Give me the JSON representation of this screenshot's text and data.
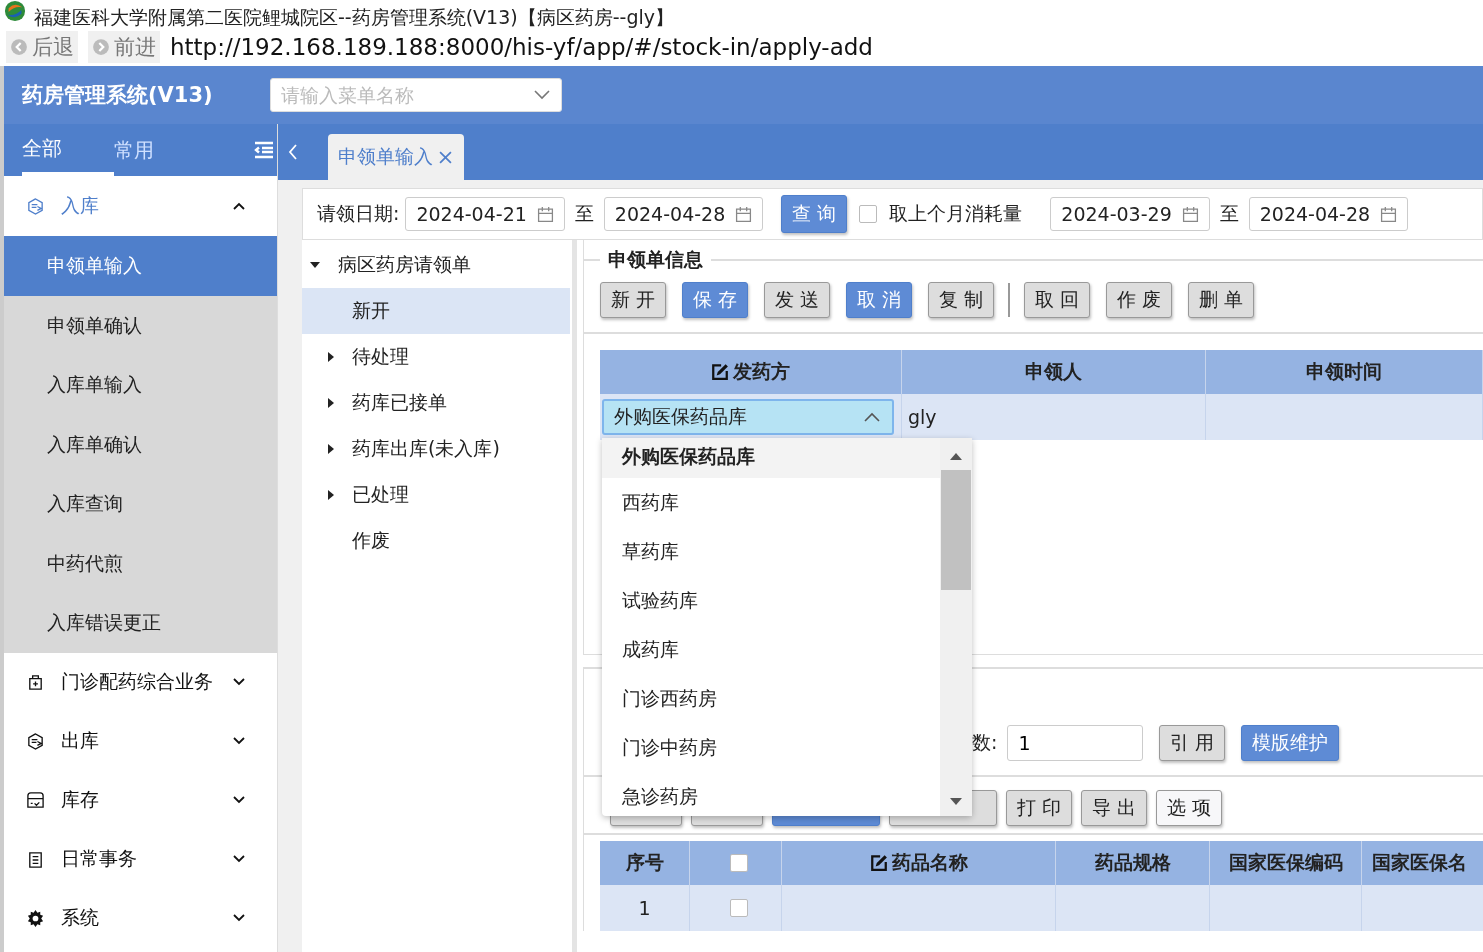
{
  "window": {
    "title": "福建医科大学附属第二医院鲤城院区--药房管理系统(V13)【病区药房--gly】",
    "back": "后退",
    "forward": "前进",
    "url": "http://192.168.189.188:8000/his-yf/app/#/stock-in/apply-add"
  },
  "header": {
    "app_name": "药房管理系统(V13)",
    "menu_search": {
      "placeholder": "请输入菜单名称"
    }
  },
  "sidebar": {
    "tabs": [
      {
        "label": "全部",
        "selected": true
      },
      {
        "label": "常用",
        "selected": false
      }
    ],
    "groups": [
      {
        "label": "入库",
        "kind": "stock-in",
        "expanded": true,
        "children": [
          {
            "label": "申领单输入",
            "selected": true
          },
          {
            "label": "申领单确认",
            "selected": false
          },
          {
            "label": "入库单输入",
            "selected": false
          },
          {
            "label": "入库单确认",
            "selected": false
          },
          {
            "label": "入库查询",
            "selected": false
          },
          {
            "label": "中药代煎",
            "selected": false
          },
          {
            "label": "入库错误更正",
            "selected": false
          }
        ]
      },
      {
        "label": "门诊配药综合业务",
        "kind": "kit",
        "expanded": false
      },
      {
        "label": "出库",
        "kind": "stock-out",
        "expanded": false
      },
      {
        "label": "库存",
        "kind": "inventory",
        "expanded": false
      },
      {
        "label": "日常事务",
        "kind": "daily",
        "expanded": false
      },
      {
        "label": "系统",
        "kind": "system",
        "expanded": false
      }
    ]
  },
  "page_tabs": [
    {
      "label": "申领单输入",
      "selected": true
    }
  ],
  "filter": {
    "label": "请领日期:",
    "date_from": "2024-04-21",
    "sep": "至",
    "date_to": "2024-04-28",
    "query_button": "查 询",
    "consumption": {
      "label": "取上个月消耗量",
      "checked": false
    },
    "cons_from": "2024-03-29",
    "cons_sep": "至",
    "cons_to": "2024-04-28"
  },
  "tree": [
    {
      "label": "病区药房请领单",
      "expanded": true,
      "children": [
        {
          "label": "新开",
          "selected": true
        },
        {
          "label": "待处理",
          "selected": false,
          "expanded": false
        },
        {
          "label": "药库已接单",
          "selected": false,
          "expanded": false
        },
        {
          "label": "药库出库(未入库)",
          "selected": false,
          "expanded": false
        },
        {
          "label": "已处理",
          "selected": false,
          "expanded": false
        },
        {
          "label": "作废",
          "selected": false
        }
      ]
    }
  ],
  "form": {
    "title": "申领单信息",
    "button_groups": [
      [
        {
          "label": "新 开",
          "kind": "default"
        },
        {
          "label": "保 存",
          "kind": "primary"
        },
        {
          "label": "发 送",
          "kind": "default"
        },
        {
          "label": "取 消",
          "kind": "primary"
        },
        {
          "label": "复 制",
          "kind": "default"
        }
      ],
      [
        {
          "label": "取 回",
          "kind": "default"
        },
        {
          "label": "作 废",
          "kind": "default"
        },
        {
          "label": "删 单",
          "kind": "default"
        }
      ]
    ],
    "columns": [
      {
        "label": "发药方",
        "editable": true
      },
      {
        "label": "申领人",
        "editable": false
      },
      {
        "label": "申领时间",
        "editable": false
      }
    ],
    "row": {
      "supplier": "外购医保药品库",
      "open": true,
      "applicant": "gly"
    },
    "supplier_options": [
      {
        "label": "外购医保药品库",
        "selected": true
      },
      {
        "label": "西药库",
        "selected": false
      },
      {
        "label": "草药库",
        "selected": false
      },
      {
        "label": "试验药库",
        "selected": false
      },
      {
        "label": "成药库",
        "selected": false
      },
      {
        "label": "门诊西药房",
        "selected": false
      },
      {
        "label": "门诊中药房",
        "selected": false
      },
      {
        "label": "急诊药房",
        "selected": false
      }
    ]
  },
  "template": {
    "label": "数:",
    "value": "1",
    "buttons": [
      {
        "label": "引 用",
        "kind": "default"
      },
      {
        "label": "模版维护",
        "kind": "primary"
      }
    ]
  },
  "detail": {
    "buttons": [
      {
        "kind": "default"
      },
      {
        "kind": "default"
      },
      {
        "kind": "primary"
      },
      {
        "kind": "default"
      },
      {
        "label": "打 印",
        "kind": "default"
      },
      {
        "label": "导 出",
        "kind": "default"
      },
      {
        "label": "选 项",
        "kind": "light"
      }
    ],
    "columns": [
      {
        "label": "序号",
        "kind": "text",
        "editable": false
      },
      {
        "kind": "checkbox",
        "checked": false
      },
      {
        "label": "药品名称",
        "kind": "text",
        "editable": true
      },
      {
        "label": "药品规格",
        "kind": "text",
        "editable": false
      },
      {
        "label": "国家医保编码",
        "kind": "text",
        "editable": false
      },
      {
        "label": "国家医保名",
        "kind": "text",
        "editable": false
      }
    ],
    "rows": [
      {
        "no": "1",
        "checked": false
      }
    ]
  }
}
